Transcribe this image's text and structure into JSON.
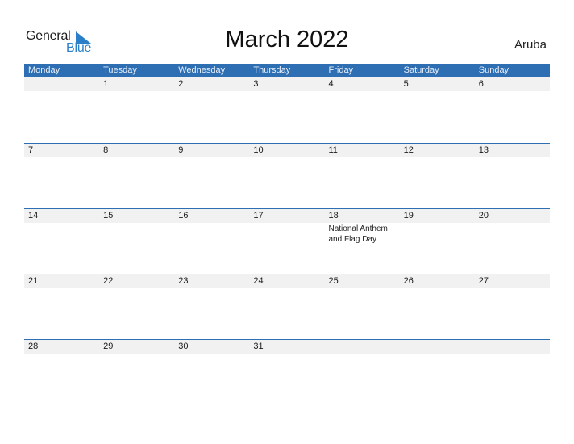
{
  "logo": {
    "word1": "General",
    "word2": "Blue"
  },
  "title": "March 2022",
  "country": "Aruba",
  "colors": {
    "header_bg": "#2e6fb4",
    "date_strip": "#f1f1f1",
    "logo_blue": "#2a7fc8"
  },
  "weekdays": [
    "Monday",
    "Tuesday",
    "Wednesday",
    "Thursday",
    "Friday",
    "Saturday",
    "Sunday"
  ],
  "weeks": [
    [
      {
        "day": ""
      },
      {
        "day": "1"
      },
      {
        "day": "2"
      },
      {
        "day": "3"
      },
      {
        "day": "4"
      },
      {
        "day": "5"
      },
      {
        "day": "6"
      }
    ],
    [
      {
        "day": "7"
      },
      {
        "day": "8"
      },
      {
        "day": "9"
      },
      {
        "day": "10"
      },
      {
        "day": "11"
      },
      {
        "day": "12"
      },
      {
        "day": "13"
      }
    ],
    [
      {
        "day": "14"
      },
      {
        "day": "15"
      },
      {
        "day": "16"
      },
      {
        "day": "17"
      },
      {
        "day": "18",
        "event": "National Anthem and Flag Day"
      },
      {
        "day": "19"
      },
      {
        "day": "20"
      }
    ],
    [
      {
        "day": "21"
      },
      {
        "day": "22"
      },
      {
        "day": "23"
      },
      {
        "day": "24"
      },
      {
        "day": "25"
      },
      {
        "day": "26"
      },
      {
        "day": "27"
      }
    ],
    [
      {
        "day": "28"
      },
      {
        "day": "29"
      },
      {
        "day": "30"
      },
      {
        "day": "31"
      },
      {
        "day": ""
      },
      {
        "day": ""
      },
      {
        "day": ""
      }
    ]
  ]
}
